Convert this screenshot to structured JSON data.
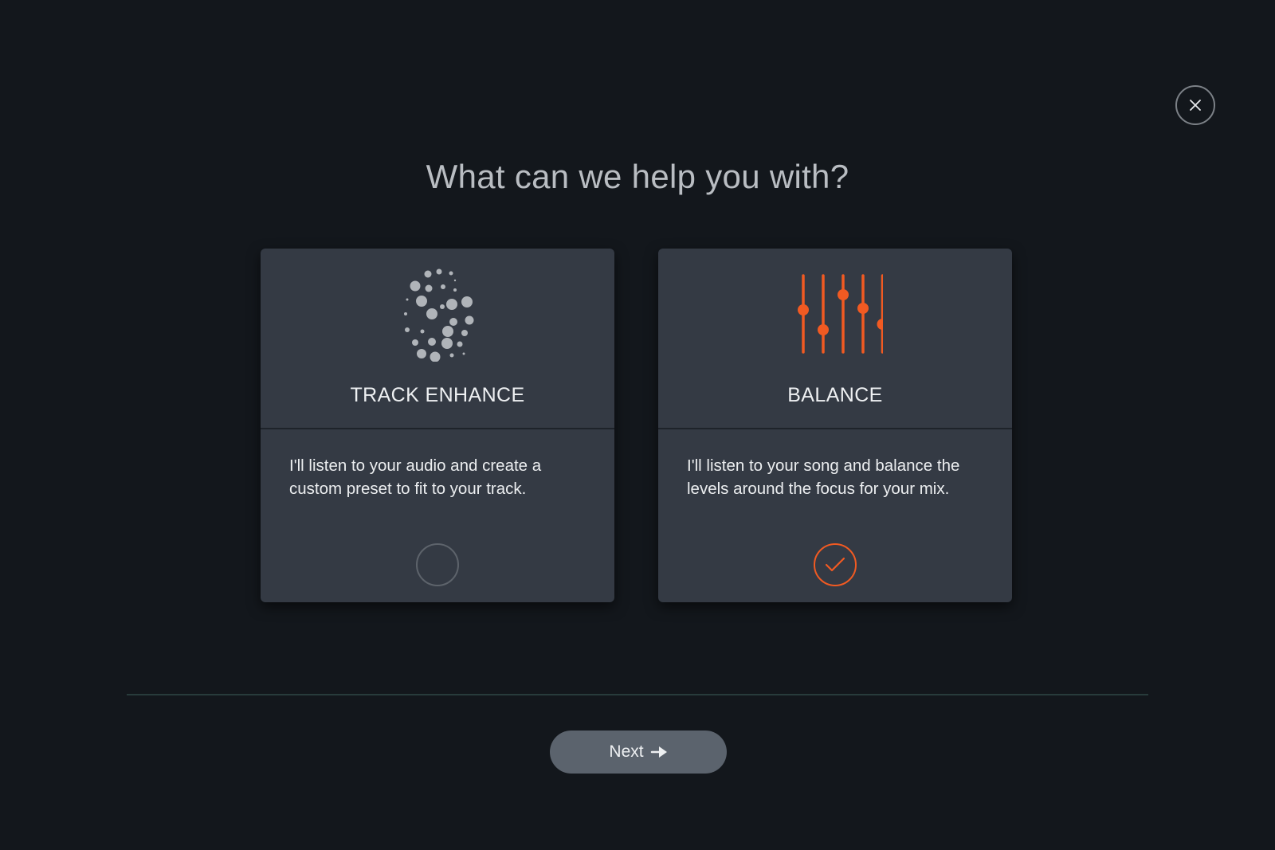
{
  "dialog": {
    "title": "What can we help you with?",
    "close_icon": "close-icon"
  },
  "options": [
    {
      "id": "track-enhance",
      "title": "TRACK ENHANCE",
      "description": "I'll listen to your audio and create a custom preset to fit to your track.",
      "icon": "dots-sphere-icon",
      "selected": false
    },
    {
      "id": "balance",
      "title": "BALANCE",
      "description": "I'll listen to your song and balance the levels around the focus for your mix.",
      "icon": "faders-icon",
      "selected": true
    }
  ],
  "footer": {
    "next_label": "Next",
    "next_icon": "arrow-right-icon"
  },
  "colors": {
    "background": "#13171c",
    "card": "#343a44",
    "accent": "#f15a22",
    "button": "#5b636d",
    "title_text": "#b9bdc2"
  }
}
